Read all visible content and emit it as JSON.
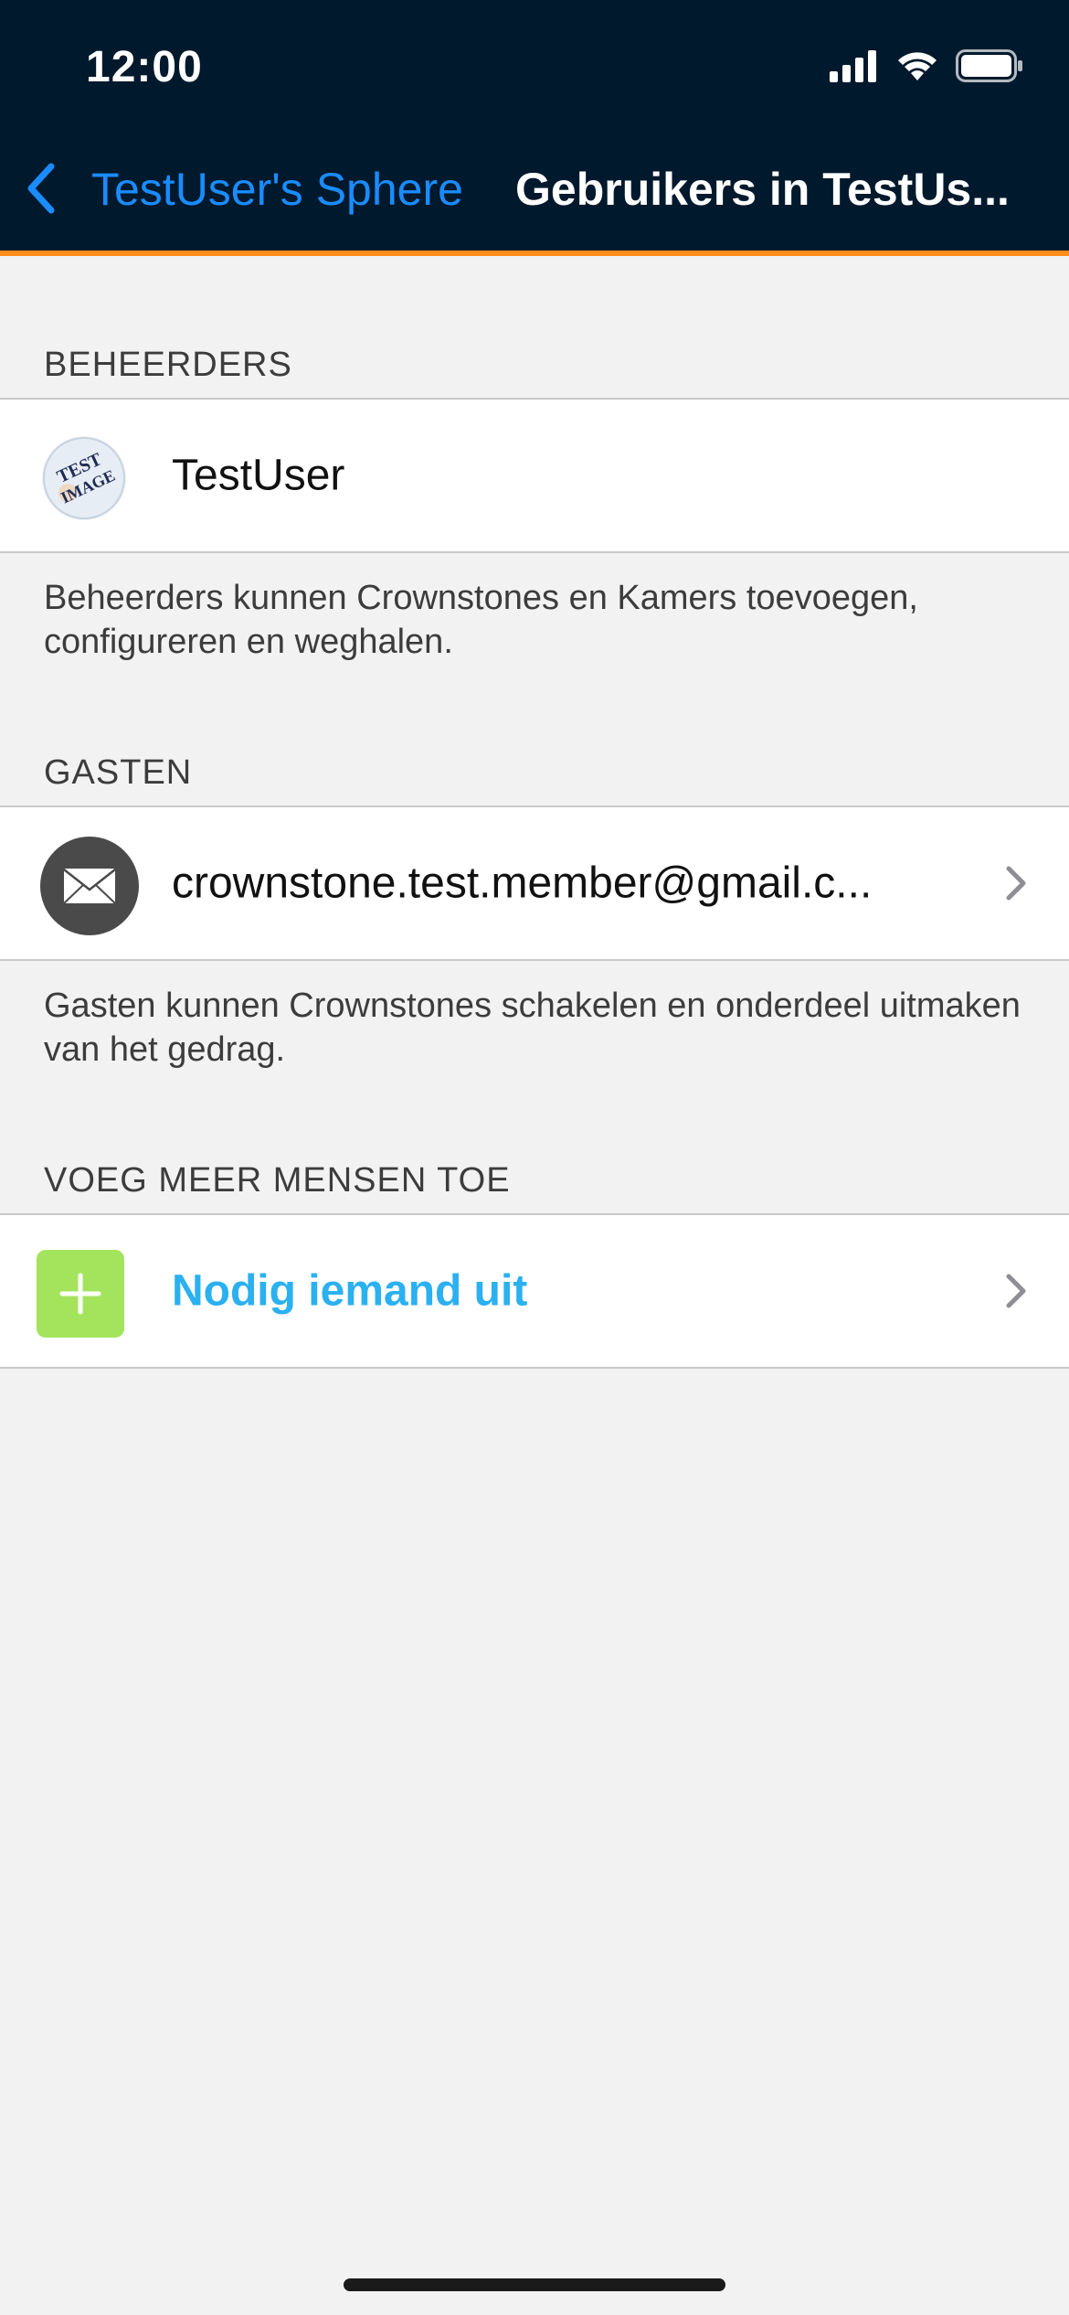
{
  "status_bar": {
    "time": "12:00",
    "signal_icon": "cellular-signal-icon",
    "wifi_icon": "wifi-icon",
    "battery_icon": "battery-icon"
  },
  "nav": {
    "back_label": "TestUser's Sphere",
    "title": "Gebruikers in TestUs...",
    "back_icon": "chevron-left-icon"
  },
  "sections": {
    "admins": {
      "header": "BEHEERDERS",
      "user_name": "TestUser",
      "avatar_text_line1": "TEST",
      "avatar_text_line2": "IMAGE",
      "footer": "Beheerders kunnen Crownstones en Kamers toevoegen, configureren en weghalen."
    },
    "guests": {
      "header": "GASTEN",
      "user_email": "crownstone.test.member@gmail.c...",
      "avatar_icon": "envelope-icon",
      "footer": "Gasten kunnen Crownstones schakelen en onderdeel uitmaken van het gedrag."
    },
    "add_people": {
      "header": "VOEG MEER MENSEN TOE",
      "invite_label": "Nodig iemand uit",
      "invite_icon": "plus-icon"
    }
  },
  "colors": {
    "header_bg": "#00192c",
    "accent": "#ff8c1a",
    "link_blue": "#1a8cff",
    "invite_blue": "#2bb0f0",
    "add_green": "#a4e45d"
  }
}
